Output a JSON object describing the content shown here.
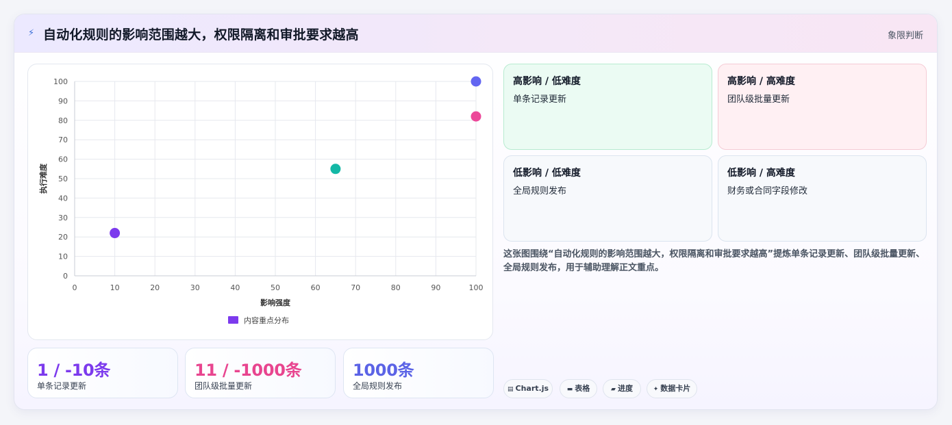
{
  "header": {
    "icon": "bolt-icon",
    "title": "自动化规则的影响范围越大，权限隔离和审批要求越高",
    "tag": "象限判断"
  },
  "chart_data": {
    "type": "scatter",
    "xlabel": "影响强度",
    "ylabel": "执行难度",
    "xlim": [
      0,
      100
    ],
    "ylim": [
      0,
      100
    ],
    "xticks": [
      "0",
      "10",
      "20",
      "30",
      "40",
      "50",
      "60",
      "70",
      "80",
      "90",
      "100"
    ],
    "yticks": [
      "0",
      "10",
      "20",
      "30",
      "40",
      "50",
      "60",
      "70",
      "80",
      "90",
      "100"
    ],
    "grid": true,
    "legend_position": "bottom",
    "series": [
      {
        "name": "内容重点分布",
        "legend_color": "#7c3aed",
        "points": [
          {
            "x": 10,
            "y": 22,
            "color": "#7c3aed"
          },
          {
            "x": 65,
            "y": 55,
            "color": "#14b8a6"
          },
          {
            "x": 100,
            "y": 82,
            "color": "#ec4899"
          },
          {
            "x": 100,
            "y": 100,
            "color": "#6366f1"
          }
        ]
      }
    ]
  },
  "stats": [
    {
      "value": "1 / -10条",
      "label": "单条记录更新",
      "color": "#7c3aed"
    },
    {
      "value": "11 / -1000条",
      "label": "团队级批量更新",
      "color": "#e8458f"
    },
    {
      "value": "1000条",
      "label": "全局规则发布",
      "color": "#5b63e6"
    }
  ],
  "quadrants": [
    {
      "title": "高影响 / 低难度",
      "text": "单条记录更新",
      "bg": "#ebfbf3",
      "border": "#b7ebd0"
    },
    {
      "title": "高影响 / 高难度",
      "text": "团队级批量更新",
      "bg": "#fff0f3",
      "border": "#f5cbd5"
    },
    {
      "title": "低影响 / 低难度",
      "text": "全局规则发布",
      "bg": "#f7f9fc",
      "border": "#dbe4ef"
    },
    {
      "title": "低影响 / 高难度",
      "text": "财务或合同字段修改",
      "bg": "#f7f9fc",
      "border": "#dbe4ef"
    }
  ],
  "description": "这张图围绕“自动化规则的影响范围越大，权限隔离和审批要求越高”提炼单条记录更新、团队级批量更新、全局规则发布，用于辅助理解正文重点。",
  "chips": [
    {
      "icon": "chart-icon",
      "glyph": "▤",
      "label": "Chart.js"
    },
    {
      "icon": "table-icon",
      "glyph": "▬",
      "label": "表格"
    },
    {
      "icon": "progress-icon",
      "glyph": "▰",
      "label": "进度"
    },
    {
      "icon": "sparkle-icon",
      "glyph": "✦",
      "label": "数据卡片"
    }
  ]
}
